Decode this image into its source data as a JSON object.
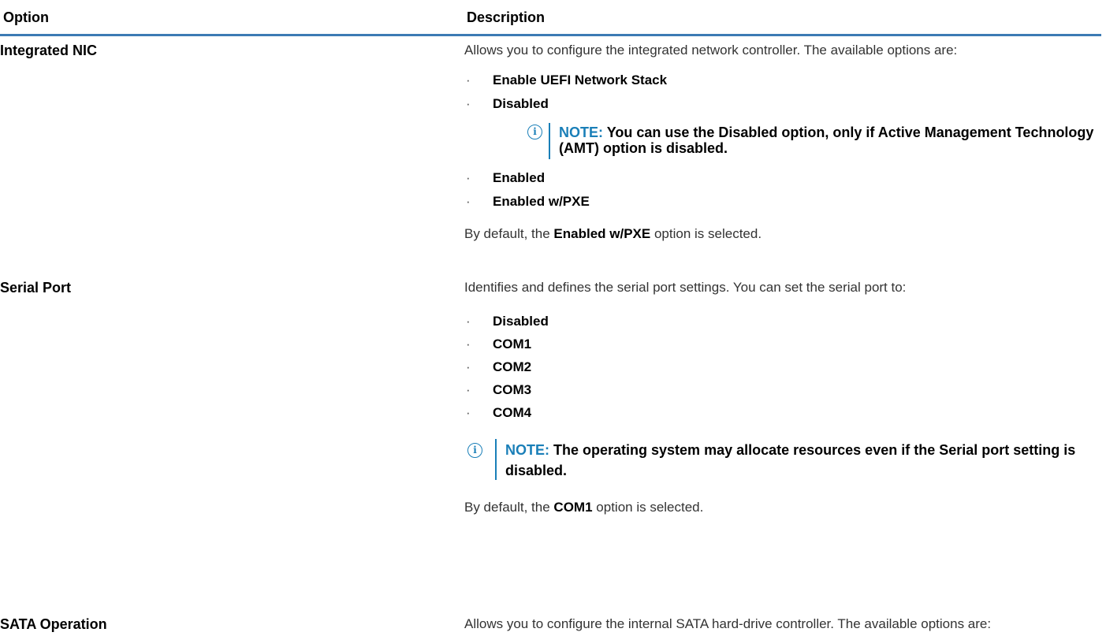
{
  "header": {
    "option": "Option",
    "description": "Description"
  },
  "rows": [
    {
      "option": "Integrated NIC",
      "description": "Allows you to configure the integrated network controller. The available options are:",
      "items": [
        "Enable UEFI Network Stack",
        "Disabled",
        "Enabled",
        "Enabled w/PXE"
      ],
      "note": {
        "label": "NOTE:",
        "text": "You can use the Disabled option, only if Active Management Technology",
        "text2": "(AMT) option is disabled."
      },
      "default": {
        "prefix": "By default, the",
        "value": "Enabled w/PXE",
        "suffix": "option is selected."
      }
    },
    {
      "option": "Serial Port",
      "description": "Identifies and defines the serial port settings. You can set the serial port to:",
      "items": [
        "Disabled",
        "COM1",
        "COM2",
        "COM3",
        "COM4"
      ],
      "note": {
        "label": "NOTE:",
        "text": "The operating system may allocate resources even if the Serial port setting is",
        "text2": "disabled."
      },
      "default": {
        "prefix": "By default, the",
        "value": "COM1",
        "suffix": "option is selected."
      }
    },
    {
      "option": "SATA Operation",
      "description": "Allows you to configure the internal SATA hard-drive controller. The available options are:"
    }
  ],
  "icons": {
    "info": "info-icon",
    "accent": "#1a7fb8",
    "rule": "#3c7bb4"
  }
}
